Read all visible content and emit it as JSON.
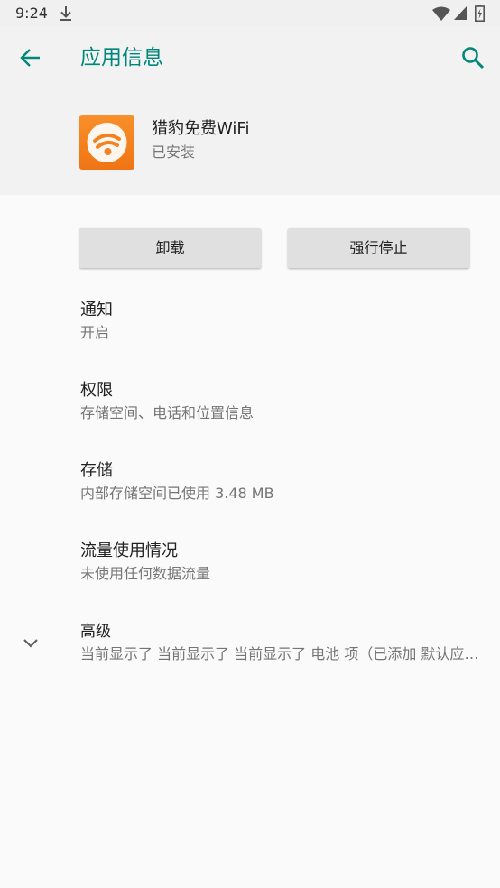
{
  "status_bar": {
    "time": "9:24",
    "icons": [
      "download-icon",
      "wifi-icon",
      "cell-signal-icon",
      "battery-icon"
    ]
  },
  "header": {
    "title": "应用信息",
    "back_icon": "arrow-left-icon",
    "search_icon": "search-icon",
    "accent_color": "#00877a"
  },
  "app": {
    "name": "猎豹免费WiFi",
    "status": "已安装",
    "icon": "wifi-app-icon",
    "icon_color": "#f38320"
  },
  "buttons": {
    "uninstall": "卸载",
    "force_stop": "强行停止"
  },
  "settings": [
    {
      "title": "通知",
      "summary": "开启"
    },
    {
      "title": "权限",
      "summary": "存储空间、电话和位置信息"
    },
    {
      "title": "存储",
      "summary": "内部存储空间已使用 3.48 MB"
    },
    {
      "title": "流量使用情况",
      "summary": "未使用任何数据流量"
    },
    {
      "title": "高级",
      "summary": "当前显示了 当前显示了 当前显示了 电池 项（已添加 默认应用 等）",
      "icon": "chevron-down-icon"
    }
  ]
}
